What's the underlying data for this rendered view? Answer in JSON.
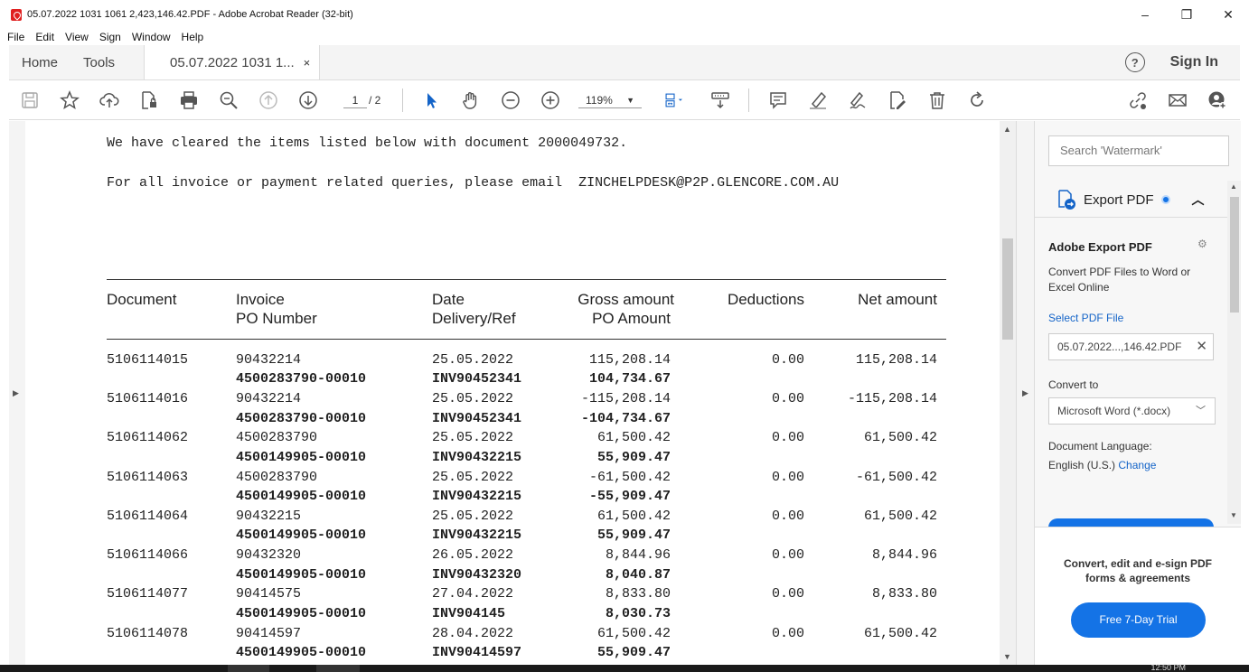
{
  "window": {
    "title": "05.07.2022 1031 1061 2,423,146.42.PDF - Adobe Acrobat Reader (32-bit)",
    "minimize": "–",
    "restore": "❐",
    "close": "✕"
  },
  "menu": [
    "File",
    "Edit",
    "View",
    "Sign",
    "Window",
    "Help"
  ],
  "tabs": {
    "home": "Home",
    "tools": "Tools",
    "document": "05.07.2022 1031 1...",
    "close": "×",
    "help": "?",
    "signin": "Sign In"
  },
  "toolbar": {
    "page_current": "1",
    "page_total": "/ 2",
    "zoom": "119%"
  },
  "document": {
    "line1": "We have cleared the items listed below with document 2000049732.",
    "line2": "For all invoice or payment related queries, please email  ZINCHELPDESK@P2P.GLENCORE.COM.AU",
    "headers": {
      "document": "Document",
      "invoice": "Invoice",
      "po_number": "PO Number",
      "date": "Date",
      "delivery_ref": "Delivery/Ref",
      "gross_amount": "Gross amount",
      "po_amount": "PO Amount",
      "deductions": "Deductions",
      "net_amount": "Net amount"
    },
    "rows": [
      {
        "document": "5106114015",
        "invoice": "90432214",
        "date": "25.05.2022",
        "gross": "115,208.14",
        "deductions": "0.00",
        "net": "115,208.14",
        "po_number": "4500283790-00010",
        "delivery_ref": "INV90452341",
        "po_amount": "104,734.67"
      },
      {
        "document": "5106114016",
        "invoice": "90432214",
        "date": "25.05.2022",
        "gross": "-115,208.14",
        "deductions": "0.00",
        "net": "-115,208.14",
        "po_number": "4500283790-00010",
        "delivery_ref": "INV90452341",
        "po_amount": "-104,734.67"
      },
      {
        "document": "5106114062",
        "invoice": "4500283790",
        "date": "25.05.2022",
        "gross": "61,500.42",
        "deductions": "0.00",
        "net": "61,500.42",
        "po_number": "4500149905-00010",
        "delivery_ref": "INV90432215",
        "po_amount": "55,909.47"
      },
      {
        "document": "5106114063",
        "invoice": "4500283790",
        "date": "25.05.2022",
        "gross": "-61,500.42",
        "deductions": "0.00",
        "net": "-61,500.42",
        "po_number": "4500149905-00010",
        "delivery_ref": "INV90432215",
        "po_amount": "-55,909.47"
      },
      {
        "document": "5106114064",
        "invoice": "90432215",
        "date": "25.05.2022",
        "gross": "61,500.42",
        "deductions": "0.00",
        "net": "61,500.42",
        "po_number": "4500149905-00010",
        "delivery_ref": "INV90432215",
        "po_amount": "55,909.47"
      },
      {
        "document": "5106114066",
        "invoice": "90432320",
        "date": "26.05.2022",
        "gross": "8,844.96",
        "deductions": "0.00",
        "net": "8,844.96",
        "po_number": "4500149905-00010",
        "delivery_ref": "INV90432320",
        "po_amount": "8,040.87"
      },
      {
        "document": "5106114077",
        "invoice": "90414575",
        "date": "27.04.2022",
        "gross": "8,833.80",
        "deductions": "0.00",
        "net": "8,833.80",
        "po_number": "4500149905-00010",
        "delivery_ref": "INV904145",
        "po_amount": "8,030.73"
      },
      {
        "document": "5106114078",
        "invoice": "90414597",
        "date": "28.04.2022",
        "gross": "61,500.42",
        "deductions": "0.00",
        "net": "61,500.42",
        "po_number": "4500149905-00010",
        "delivery_ref": "INV90414597",
        "po_amount": "55,909.47"
      }
    ]
  },
  "panel": {
    "search_placeholder": "Search 'Watermark'",
    "export_label": "Export PDF",
    "title": "Adobe Export PDF",
    "description": "Convert PDF Files to Word or Excel Online",
    "select_file": "Select PDF File",
    "file_name": "05.07.2022...,146.42.PDF",
    "convert_to": "Convert to",
    "format": "Microsoft Word (*.docx)",
    "doc_language_label": "Document Language:",
    "doc_language": "English (U.S.)",
    "change": "Change",
    "promo_text": "Convert, edit and e-sign PDF forms & agreements",
    "trial_button": "Free 7-Day Trial"
  },
  "taskbar": {
    "clock": "12:50 PM"
  }
}
